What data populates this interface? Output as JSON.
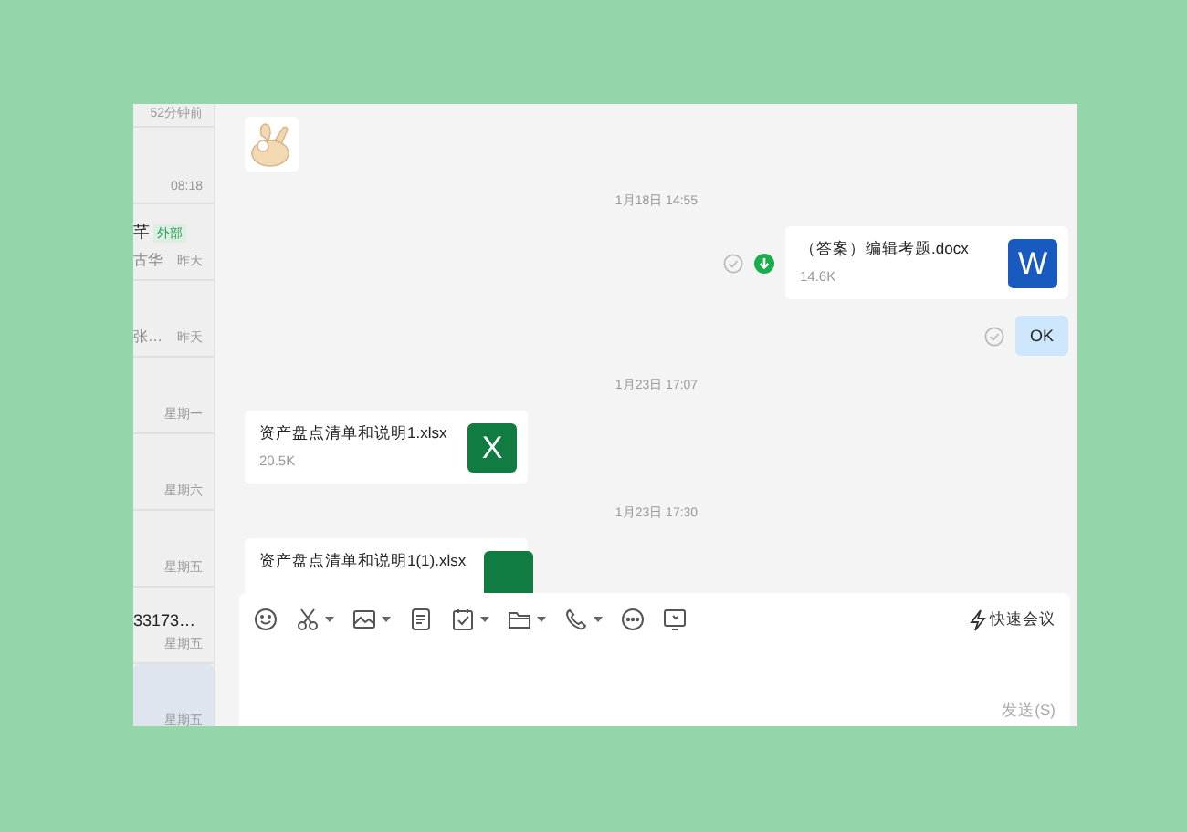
{
  "sidebar": {
    "items": [
      {
        "time": "52分钟前",
        "selected": false
      },
      {
        "time": "08:18",
        "selected": false
      },
      {
        "name": "芊",
        "tag": "外部",
        "preview": "古华",
        "time": "昨天",
        "selected": false
      },
      {
        "preview": "张…",
        "time": "昨天",
        "selected": false
      },
      {
        "time": "星期一",
        "selected": false
      },
      {
        "time": "星期六",
        "selected": false
      },
      {
        "time": "星期五",
        "selected": false
      },
      {
        "name": "33173…",
        "time": "星期五",
        "selected": false
      },
      {
        "time": "星期五",
        "selected": true
      }
    ]
  },
  "messages": [
    {
      "kind": "sticker",
      "outgoing": false
    },
    {
      "kind": "time",
      "text": "1月18日 14:55"
    },
    {
      "kind": "file",
      "outgoing": true,
      "name": "（答案）编辑考题.docx",
      "size": "14.6K",
      "color": "#185abd",
      "icon_letter": "W",
      "read": false,
      "download": true
    },
    {
      "kind": "text",
      "outgoing": true,
      "text": "OK",
      "read": false
    },
    {
      "kind": "time",
      "text": "1月23日 17:07"
    },
    {
      "kind": "file",
      "outgoing": false,
      "name": "资产盘点清单和说明1.xlsx",
      "size": "20.5K",
      "color": "#107c41",
      "icon_letter": "X"
    },
    {
      "kind": "time",
      "text": "1月23日 17:30"
    },
    {
      "kind": "file",
      "outgoing": false,
      "name": "资产盘点清单和说明1(1).xlsx",
      "color": "#107c41"
    }
  ],
  "composer": {
    "tools": [
      {
        "kind": "emoji",
        "caret": false
      },
      {
        "kind": "scissors",
        "caret": true
      },
      {
        "kind": "image",
        "caret": true
      },
      {
        "kind": "document",
        "caret": false
      },
      {
        "kind": "task",
        "caret": true
      },
      {
        "kind": "folder",
        "caret": true
      },
      {
        "kind": "phone",
        "caret": true
      },
      {
        "kind": "more",
        "caret": false
      },
      {
        "kind": "screen",
        "caret": false
      }
    ],
    "quick_meeting": "快速会议",
    "send": "发送(S)"
  }
}
